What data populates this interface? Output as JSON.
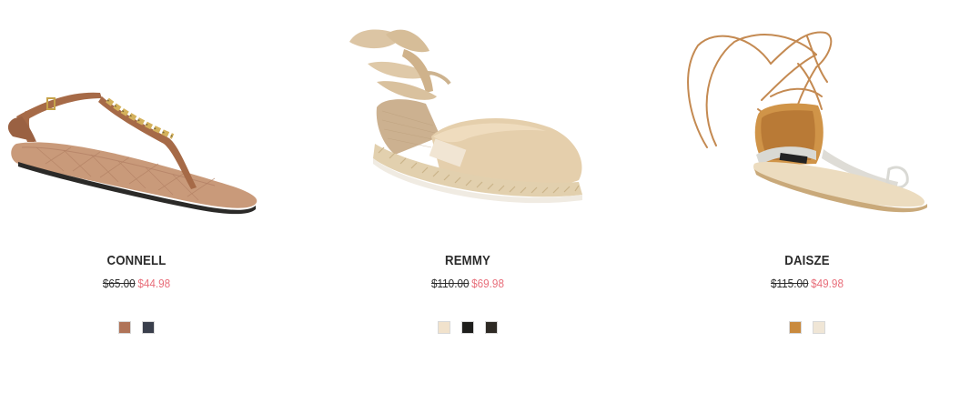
{
  "products": [
    {
      "name": "CONNELL",
      "original_price": "$65.00",
      "sale_price": "$44.98",
      "image_icon": "thong-sandal-chain-image",
      "swatches": [
        {
          "name": "cognac",
          "color": "#b07458"
        },
        {
          "name": "navy",
          "color": "#3a3f4c"
        }
      ]
    },
    {
      "name": "REMMY",
      "original_price": "$110.00",
      "sale_price": "$69.98",
      "image_icon": "espadrille-flat-lace-up-image",
      "swatches": [
        {
          "name": "natural",
          "color": "#f1e2cc"
        },
        {
          "name": "black",
          "color": "#1e1e1c"
        },
        {
          "name": "black-leopard",
          "color": "#2e2a24"
        }
      ]
    },
    {
      "name": "DAISZE",
      "original_price": "$115.00",
      "sale_price": "$49.98",
      "image_icon": "gladiator-lace-up-sandal-image",
      "swatches": [
        {
          "name": "cognac",
          "color": "#c98a3e"
        },
        {
          "name": "bone",
          "color": "#f0e6d6"
        }
      ]
    }
  ]
}
